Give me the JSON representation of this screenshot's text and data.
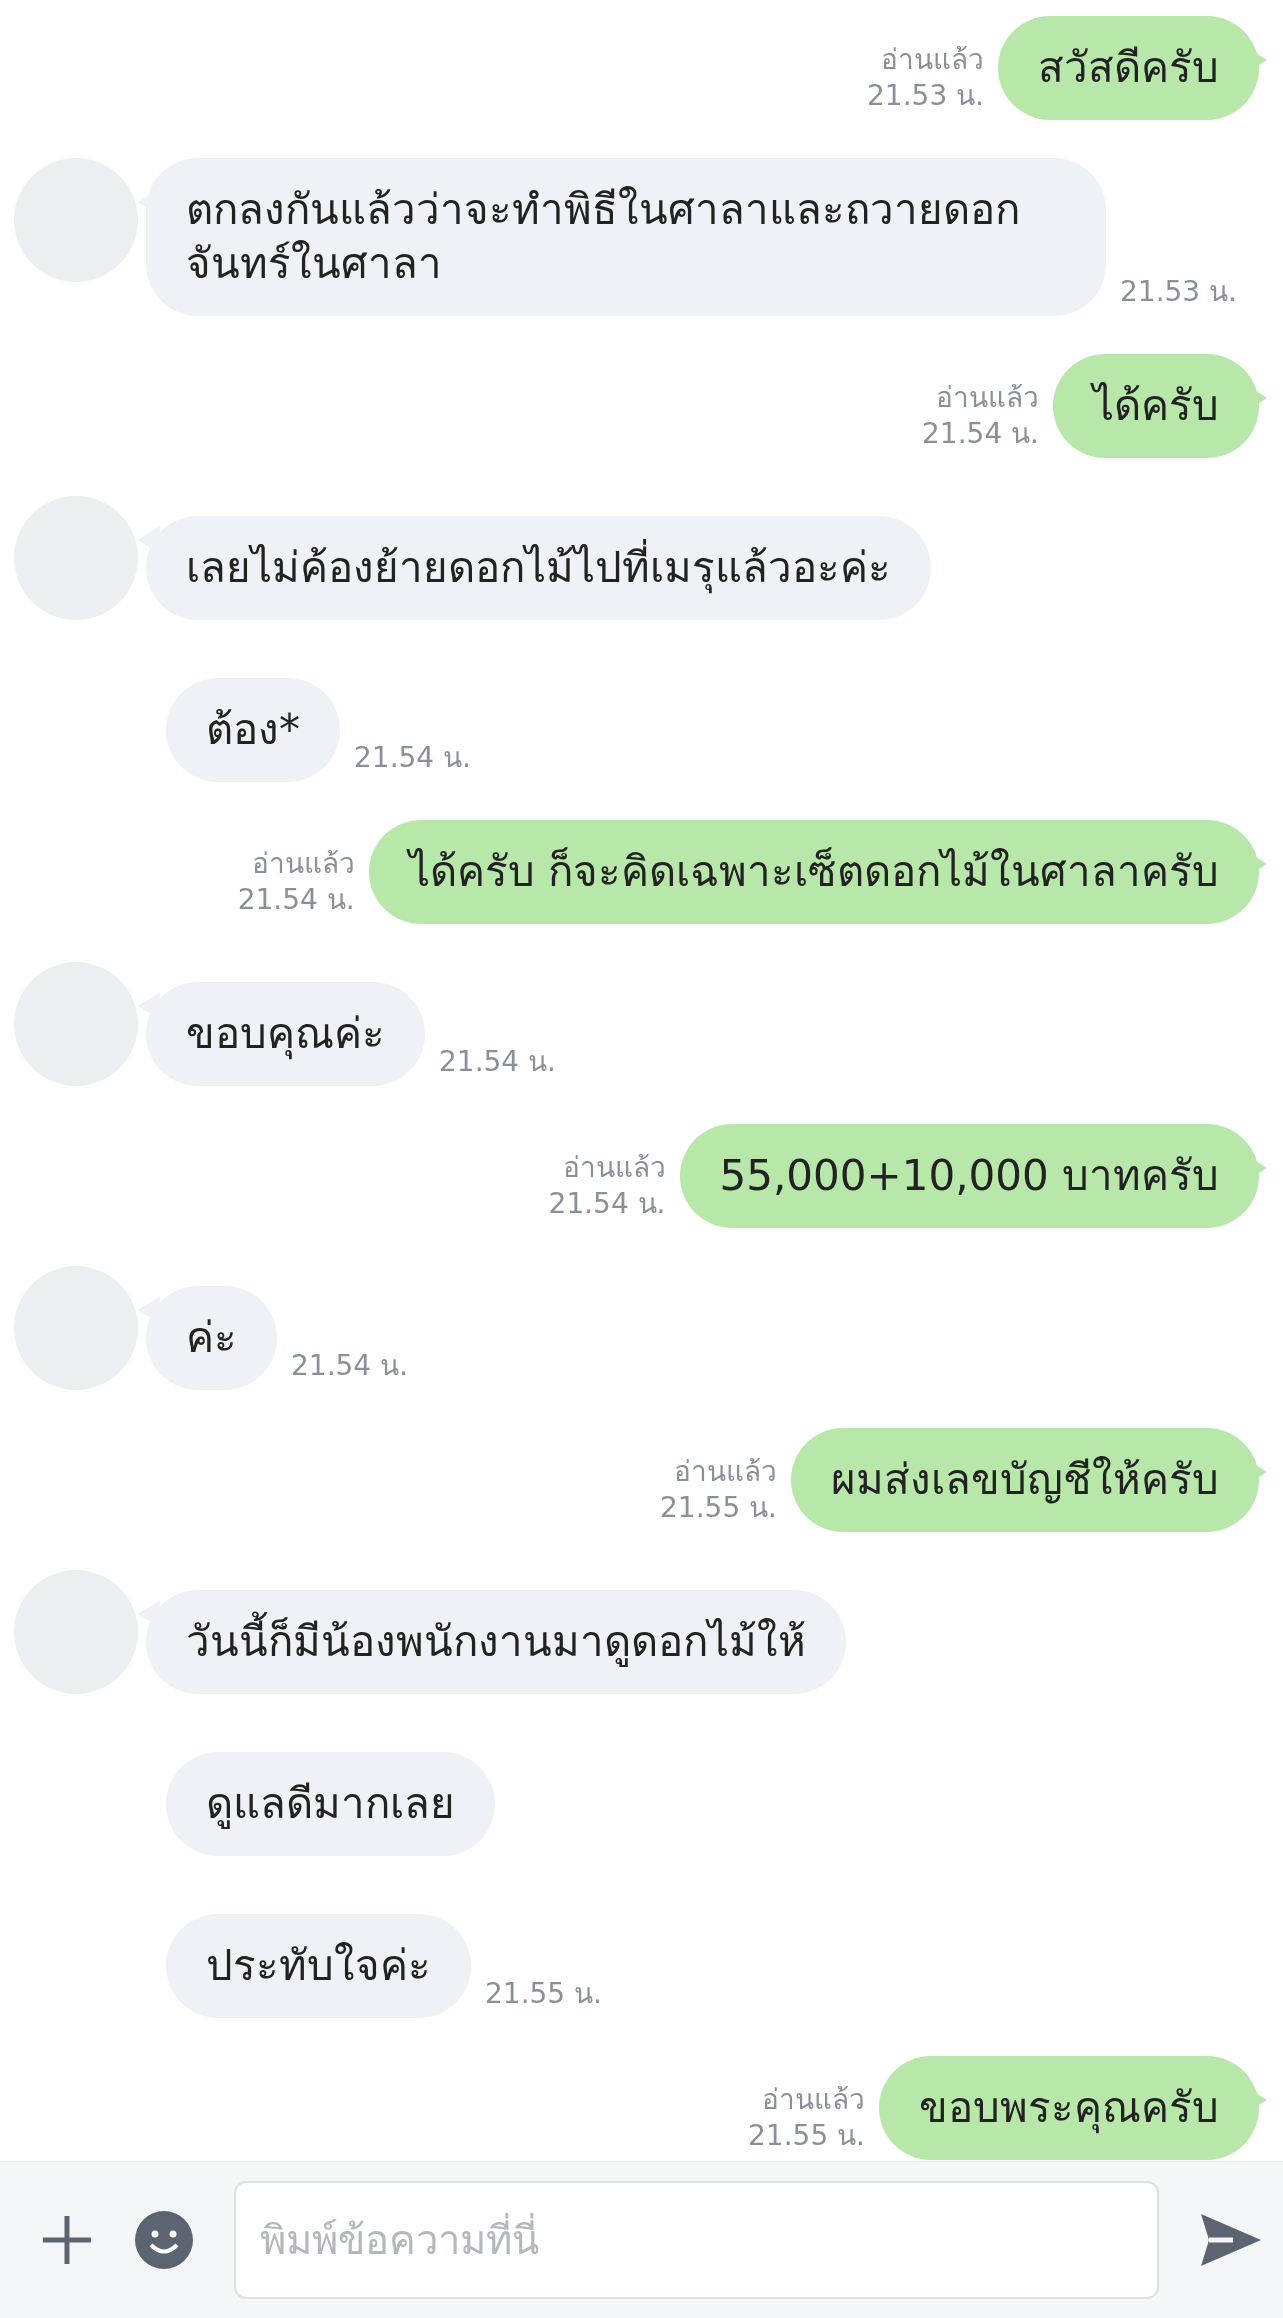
{
  "messages": [
    {
      "kind": "out",
      "text": "สวัสดีครับ",
      "read": "อ่านแล้ว",
      "time": "21.53 น."
    },
    {
      "kind": "in",
      "avatar": true,
      "text": "ตกลงกันแล้วว่าจะทำพิธีในศาลาและถวายดอกจันทร์ในศาลา",
      "time": "21.53 น."
    },
    {
      "kind": "out",
      "text": "ได้ครับ",
      "read": "อ่านแล้ว",
      "time": "21.54 น."
    },
    {
      "kind": "in",
      "avatar": true,
      "text": "เลยไม่ค้องย้ายดอกไม้ไปที่เมรุแล้วอะค่ะ"
    },
    {
      "kind": "in",
      "avatar": false,
      "text": "ต้อง*",
      "time": "21.54 น."
    },
    {
      "kind": "out",
      "text": "ได้ครับ ก็จะคิดเฉพาะเซ็ตดอกไม้ในศาลาครับ",
      "read": "อ่านแล้ว",
      "time": "21.54 น."
    },
    {
      "kind": "in",
      "avatar": true,
      "text": "ขอบคุณค่ะ",
      "time": "21.54 น."
    },
    {
      "kind": "out",
      "text": "55,000+10,000 บาทครับ",
      "read": "อ่านแล้ว",
      "time": "21.54 น."
    },
    {
      "kind": "in",
      "avatar": true,
      "text": "ค่ะ",
      "time": "21.54 น."
    },
    {
      "kind": "out",
      "text": "ผมส่งเลขบัญชีให้ครับ",
      "read": "อ่านแล้ว",
      "time": "21.55 น."
    },
    {
      "kind": "in",
      "avatar": true,
      "text": "วันนี้ก็มีน้องพนักงานมาดูดอกไม้ให้"
    },
    {
      "kind": "in",
      "avatar": false,
      "text": "ดูแลดีมากเลย"
    },
    {
      "kind": "in",
      "avatar": false,
      "text": "ประทับใจค่ะ",
      "time": "21.55 น."
    },
    {
      "kind": "out",
      "text": "ขอบพระคุณครับ",
      "read": "อ่านแล้ว",
      "time": "21.55 น."
    }
  ],
  "composer": {
    "placeholder": "พิมพ์ข้อความที่นี่"
  }
}
